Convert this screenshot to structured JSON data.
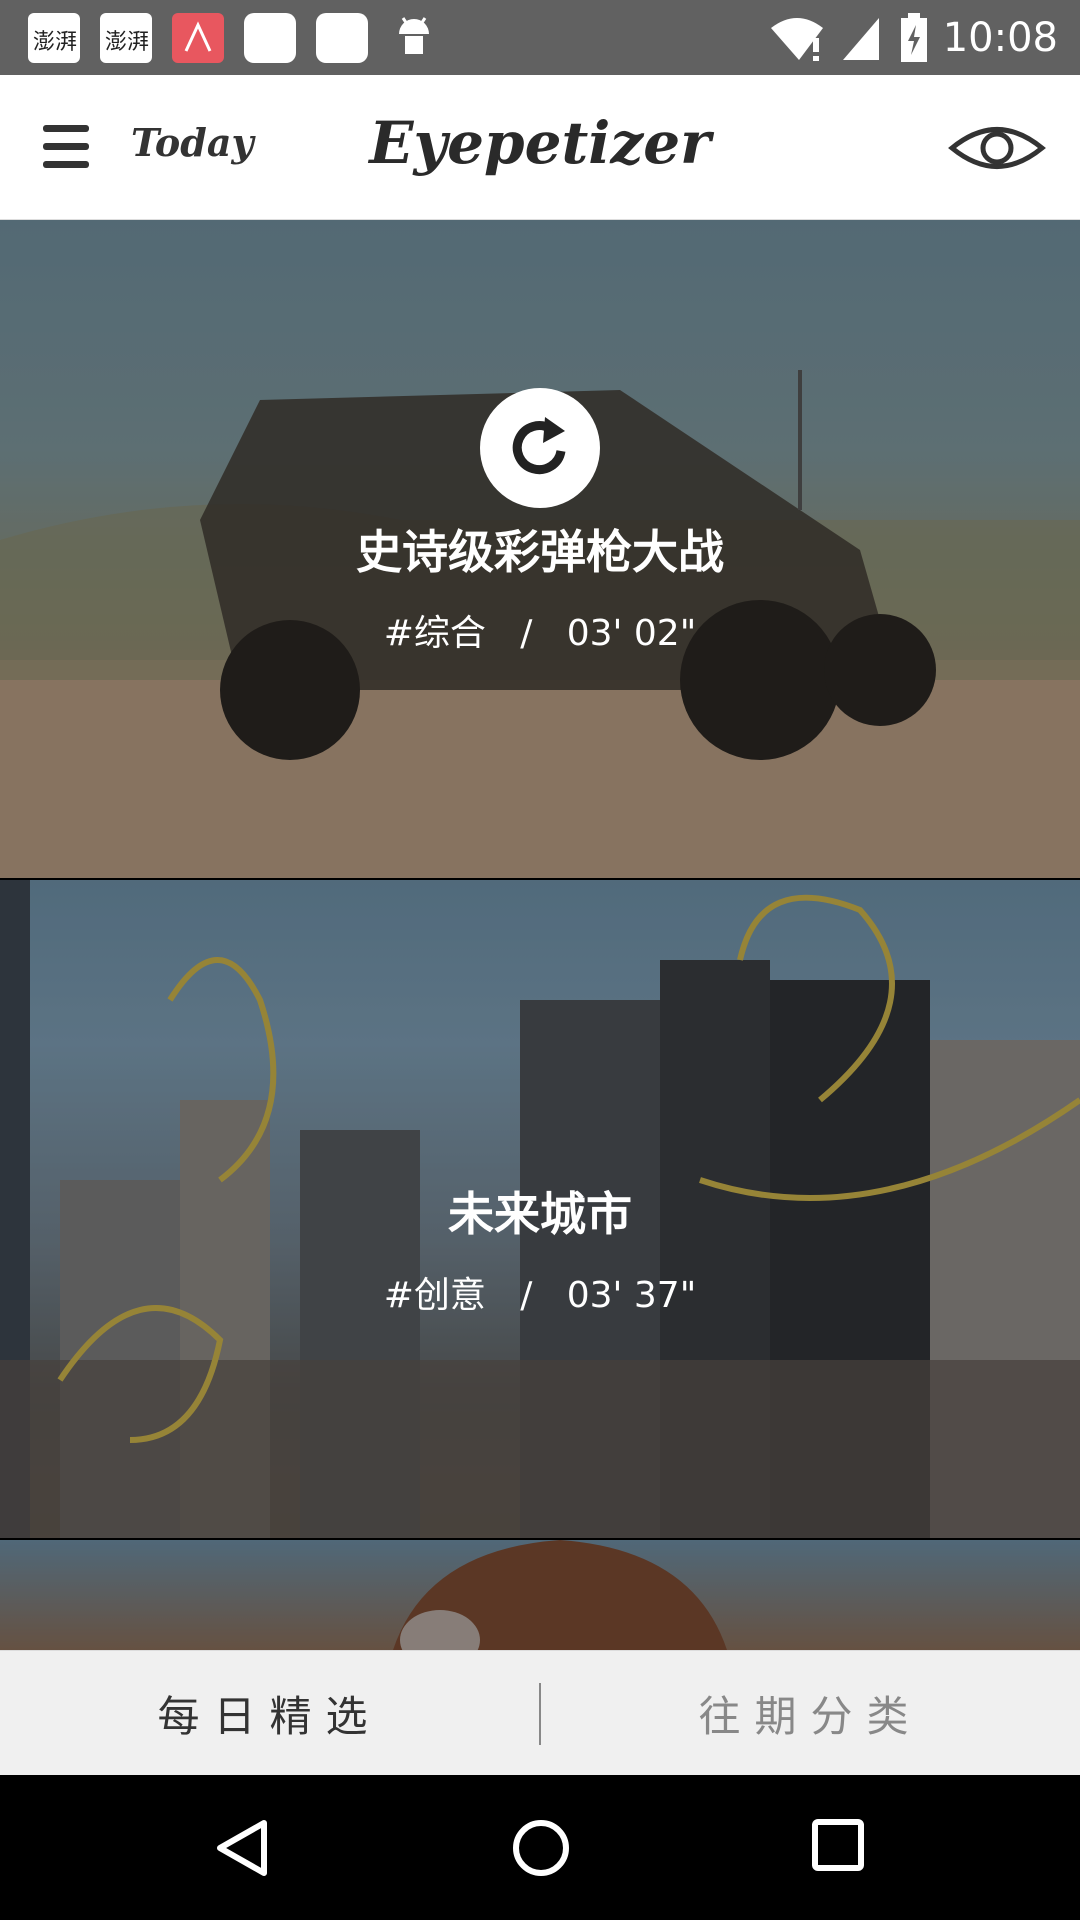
{
  "status_bar": {
    "time": "10:08",
    "notifications": [
      "澎湃",
      "澎湃"
    ]
  },
  "app_bar": {
    "today_label": "Today",
    "title": "Eyepetizer",
    "icons": [
      "menu-icon",
      "eye-icon"
    ]
  },
  "feed": {
    "cards": [
      {
        "title": "史诗级彩弹枪大战",
        "category": "#综合",
        "separator": "/",
        "duration": "03' 02\""
      },
      {
        "title": "未来城市",
        "category": "#创意",
        "separator": "/",
        "duration": "03' 37\""
      }
    ]
  },
  "tabs": {
    "daily": "每日精选",
    "categories": "往期分类"
  },
  "nav": {
    "icons": [
      "back-icon",
      "home-icon",
      "recents-icon"
    ]
  }
}
